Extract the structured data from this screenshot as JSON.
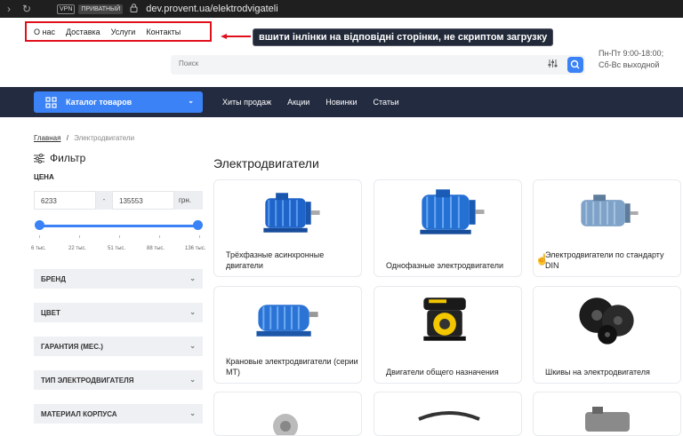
{
  "browser": {
    "vpn_badge": "VPN",
    "private_badge": "ПРИВАТНЫЙ",
    "url": "dev.provent.ua/elektrodvigateli"
  },
  "top_links": [
    "О нас",
    "Доставка",
    "Услуги",
    "Контакты"
  ],
  "annotation": "вшити інлінки на відповідні сторінки, не скриптом загрузку",
  "search": {
    "placeholder": "Поиск"
  },
  "hours": {
    "line1": "Пн-Пт 9:00-18:00;",
    "line2": "Сб-Вс выходной"
  },
  "catalog_button": "Каталог товаров",
  "main_nav": [
    "Хиты продаж",
    "Акции",
    "Новинки",
    "Статьи"
  ],
  "breadcrumb": {
    "home": "Главная",
    "separator": "/",
    "current": "Электродвигатели"
  },
  "filter": {
    "title": "Фильтр",
    "price_label": "ЦЕНА",
    "min": "6233",
    "dash": "-",
    "max": "135553",
    "unit": "грн.",
    "scale_labels": [
      "6 тыс.",
      "22 тыс.",
      "51 тыс.",
      "88 тыс.",
      "136 тыс."
    ],
    "facets": [
      "БРЕНД",
      "ЦВЕТ",
      "ГАРАНТИЯ (МЕС.)",
      "ТИП ЭЛЕКТРОДВИГАТЕЛЯ",
      "МАТЕРИАЛ КОРПУСА"
    ]
  },
  "content_title": "Электродвигатели",
  "categories": [
    {
      "label": "Трёхфазные асинхронные двигатели",
      "image": "blue-motor"
    },
    {
      "label": "Однофазные электродвигатели",
      "image": "blue-motor"
    },
    {
      "label": "Электродвигатели по стандарту DIN",
      "image": "grey-motor"
    },
    {
      "label": "Крановые электродвигатели (серии MT)",
      "image": "blue-crane-motor"
    },
    {
      "label": "Двигатели общего назначения",
      "image": "yellow-engine"
    },
    {
      "label": "Шкивы на электродвигателя",
      "image": "black-pulleys"
    }
  ],
  "colors": {
    "accent": "#3b82f6",
    "navbar": "#232b40",
    "annotation_border": "#e0101b"
  }
}
